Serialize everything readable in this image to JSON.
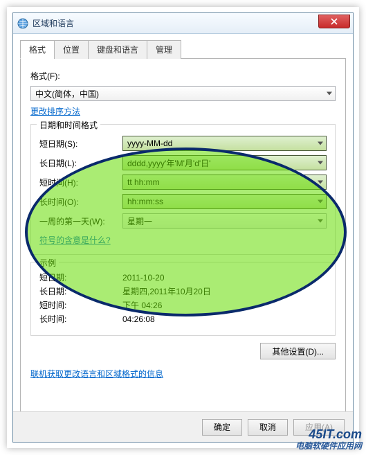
{
  "window": {
    "title": "区域和语言"
  },
  "tabs": [
    "格式",
    "位置",
    "键盘和语言",
    "管理"
  ],
  "active_tab": 0,
  "format": {
    "label": "格式(F):",
    "value": "中文(简体，中国)",
    "sort_link": "更改排序方法"
  },
  "datetime_group": {
    "title": "日期和时间格式",
    "rows": {
      "short_date": {
        "label": "短日期(S):",
        "value": "yyyy-MM-dd"
      },
      "long_date": {
        "label": "长日期(L):",
        "value": "dddd,yyyy'年'M'月'd'日'"
      },
      "short_time": {
        "label": "短时间(H):",
        "value": "tt hh:mm"
      },
      "long_time": {
        "label": "长时间(O):",
        "value": "hh:mm:ss"
      },
      "first_day": {
        "label": "一周的第一天(W):",
        "value": "星期一"
      }
    },
    "meaning_link": "符号的含意是什么?"
  },
  "example_group": {
    "title": "示例",
    "rows": {
      "short_date": {
        "label": "短日期:",
        "value": "2011-10-20"
      },
      "long_date": {
        "label": "长日期:",
        "value": "星期四,2011年10月20日"
      },
      "short_time": {
        "label": "短时间:",
        "value": "下午 04:26"
      },
      "long_time": {
        "label": "长时间:",
        "value": "04:26:08"
      }
    }
  },
  "other_settings_btn": "其他设置(D)...",
  "online_link": "联机获取更改语言和区域格式的信息",
  "buttons": {
    "ok": "确定",
    "cancel": "取消",
    "apply": "应用(A)"
  },
  "watermark": {
    "line1": "45IT.com",
    "line2": "电脑软硬件应用网"
  }
}
